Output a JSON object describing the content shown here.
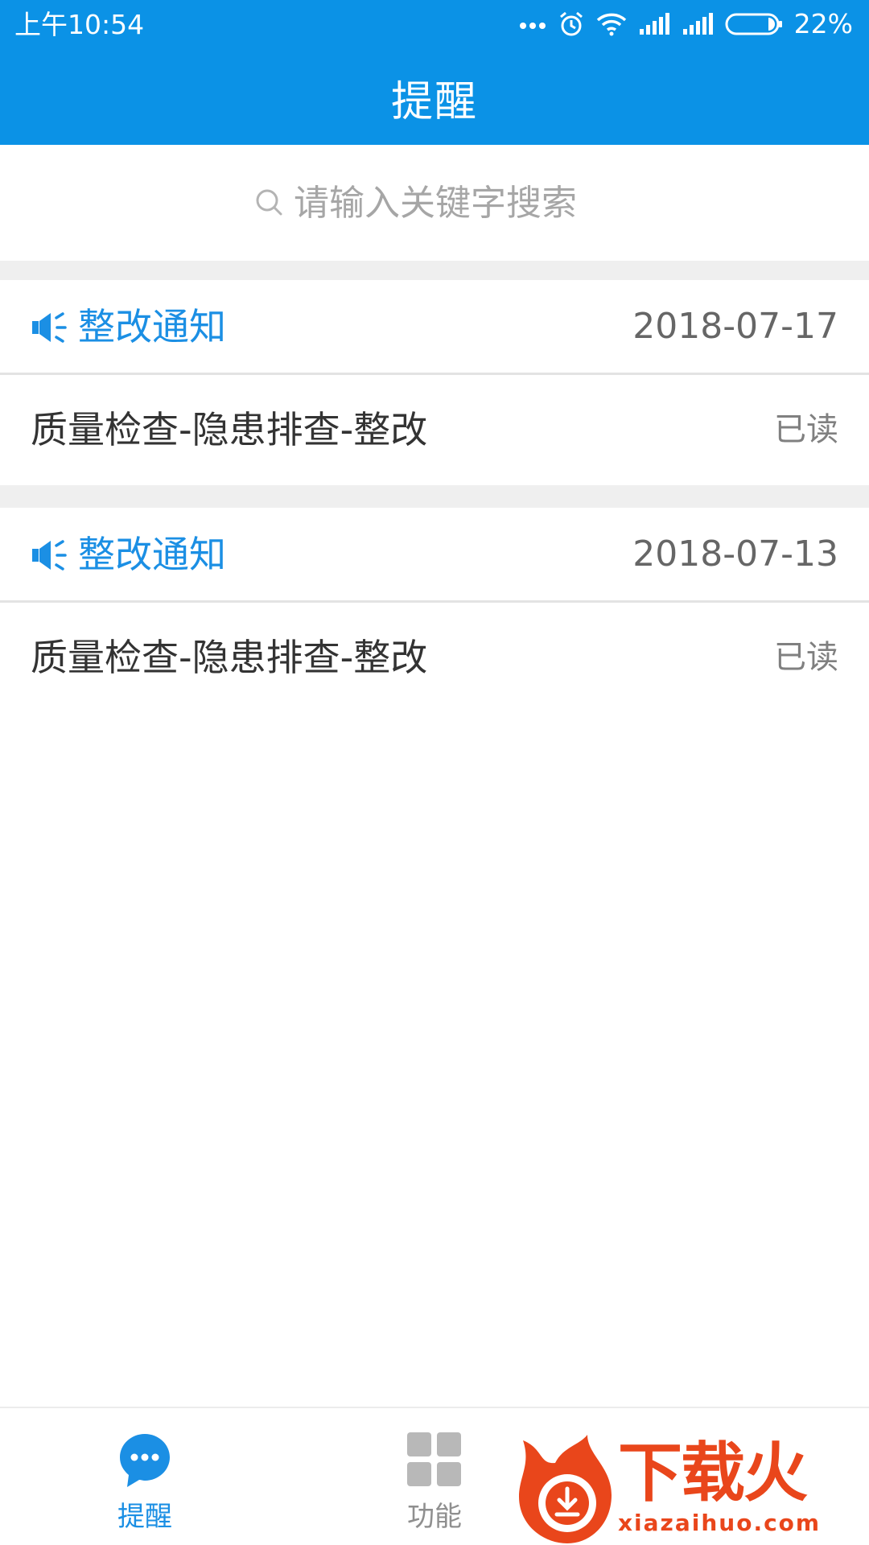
{
  "status_bar": {
    "time": "上午10:54",
    "battery": "22%",
    "icons": [
      "more-dots-icon",
      "alarm-icon",
      "wifi-icon",
      "signal-icon",
      "signal-icon",
      "battery-icon"
    ]
  },
  "header": {
    "title": "提醒"
  },
  "search": {
    "placeholder": "请输入关键字搜索"
  },
  "notices": [
    {
      "type": "整改通知",
      "date": "2018-07-17",
      "text": "质量检查-隐患排查-整改",
      "status": "已读"
    },
    {
      "type": "整改通知",
      "date": "2018-07-13",
      "text": "质量检查-隐患排查-整改",
      "status": "已读"
    }
  ],
  "bottom_nav": {
    "items": [
      {
        "label": "提醒",
        "icon": "chat-bubble-icon",
        "active": true
      },
      {
        "label": "功能",
        "icon": "grid-icon",
        "active": false
      }
    ]
  },
  "watermark": {
    "cn": "下载火",
    "en": "xiazaihuo.com"
  },
  "colors": {
    "primary": "#0b92e6",
    "accent_text": "#1b8fe4",
    "watermark": "#e9461b"
  }
}
